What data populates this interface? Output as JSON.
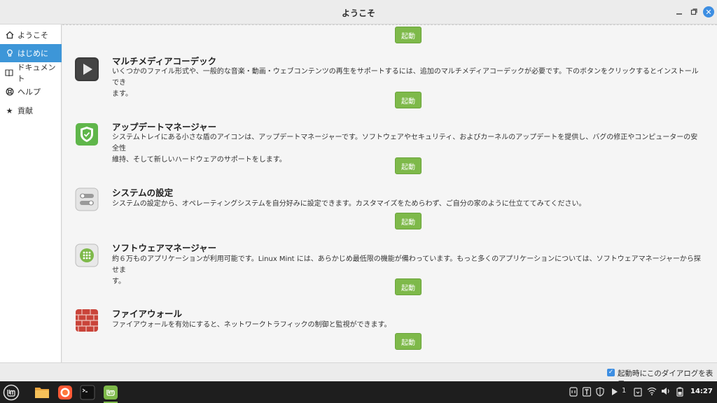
{
  "window": {
    "title": "ようこそ"
  },
  "sidebar": {
    "items": [
      {
        "label": "ようこそ",
        "icon": "home-icon"
      },
      {
        "label": "はじめに",
        "icon": "lightbulb-icon",
        "active": true
      },
      {
        "label": "ドキュメント",
        "icon": "book-icon"
      },
      {
        "label": "ヘルプ",
        "icon": "lifebuoy-icon"
      },
      {
        "label": "貢献",
        "icon": "star-icon"
      }
    ]
  },
  "main": {
    "top_launch_label": "起動",
    "sections": [
      {
        "title": "マルチメディアコーデック",
        "desc_line1": "いくつかのファイル形式や、一般的な音楽・動画・ウェブコンテンツの再生をサポートするには、追加のマルチメディアコーデックが必要です。下のボタンをクリックするとインストールでき",
        "desc_line2": "ます。",
        "launch_label": "起動",
        "icon": "play-icon"
      },
      {
        "title": "アップデートマネージャー",
        "desc_line1": "システムトレイにある小さな盾のアイコンは、アップデートマネージャーです。ソフトウェアやセキュリティ、およびカーネルのアップデートを提供し、バグの修正やコンピューターの安全性",
        "desc_line2": "維持、そして新しいハードウェアのサポートをします。",
        "launch_label": "起動",
        "icon": "shield-icon"
      },
      {
        "title": "システムの設定",
        "desc_line1": "システムの設定から、オペレーティングシステムを自分好みに設定できます。カスタマイズをためらわず、ご自分の家のように仕立ててみてください。",
        "desc_line2": "",
        "launch_label": "起動",
        "icon": "toggle-settings-icon"
      },
      {
        "title": "ソフトウェアマネージャー",
        "desc_line1": "約６万ものアプリケーションが利用可能です。Linux Mint には、あらかじめ最低限の機能が備わっています。もっと多くのアプリケーションについては、ソフトウェアマネージャーから探せま",
        "desc_line2": "す。",
        "launch_label": "起動",
        "icon": "app-grid-icon"
      },
      {
        "title": "ファイアウォール",
        "desc_line1": "ファイアウォールを有効にすると、ネットワークトラフィックの制御と監視ができます。",
        "desc_line2": "",
        "launch_label": "起動",
        "icon": "brick-wall-icon"
      }
    ]
  },
  "footer": {
    "show_on_startup_label": "起動時にこのダイアログを表示",
    "checked": true
  },
  "taskbar": {
    "apps": [
      "mint-menu-icon",
      "folder-icon",
      "firefox-icon",
      "terminal-icon",
      "mint-welcome-icon"
    ],
    "tray_notification_count": "1",
    "clock": "14:27"
  },
  "colors": {
    "accent": "#3d96d8",
    "launch_green": "#7eb94a",
    "taskbar": "#1e1e1e"
  }
}
